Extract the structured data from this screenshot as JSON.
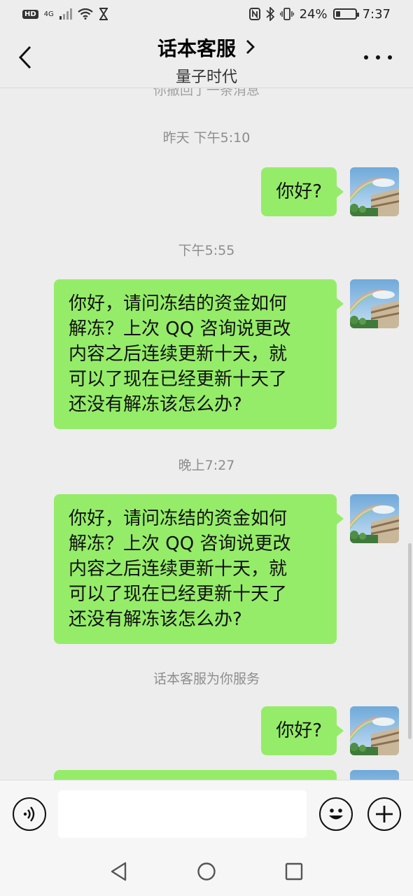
{
  "status_bar": {
    "hd_badge": "HD",
    "network": "4G",
    "battery_percent": "24%",
    "battery_level": 0.24,
    "time": "7:37"
  },
  "header": {
    "title": "话本客服",
    "subtitle": "量子时代"
  },
  "chat": {
    "partial_notice": "你撤回了一条消息",
    "messages": [
      {
        "type": "time",
        "text": "昨天 下午5:10"
      },
      {
        "type": "sent",
        "lines": [
          "你好?"
        ]
      },
      {
        "type": "time",
        "text": "下午5:55"
      },
      {
        "type": "sent",
        "lines": [
          "你好，请问冻结的资金如何",
          "解冻？上次 QQ 咨询说更改",
          "内容之后连续更新十天，就",
          "可以了现在已经更新十天了",
          "还没有解冻该怎么办?"
        ]
      },
      {
        "type": "time",
        "text": "晚上7:27"
      },
      {
        "type": "sent",
        "lines": [
          "你好，请问冻结的资金如何",
          "解冻？上次 QQ 咨询说更改",
          "内容之后连续更新十天，就",
          "可以了现在已经更新十天了",
          "还没有解冻该怎么办?"
        ]
      },
      {
        "type": "system",
        "text": "话本客服为你服务"
      },
      {
        "type": "sent",
        "lines": [
          "你好?"
        ]
      }
    ]
  },
  "input_bar": {
    "voice_icon": "voice-icon",
    "emoji_icon": "emoji-icon",
    "plus_icon": "plus-icon",
    "text_value": ""
  },
  "colors": {
    "bubble_green": "#95ec69",
    "background": "#ededed"
  }
}
